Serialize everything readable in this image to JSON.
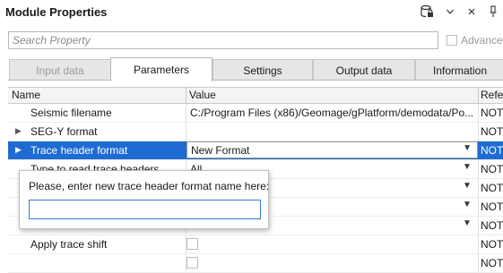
{
  "panel": {
    "title": "Module Properties",
    "search_placeholder": "Search Property",
    "advanced_label": "Advance"
  },
  "tabs": [
    {
      "label": "Input data",
      "state": "disabled"
    },
    {
      "label": "Parameters",
      "state": "active"
    },
    {
      "label": "Settings",
      "state": "normal"
    },
    {
      "label": "Output data",
      "state": "normal"
    },
    {
      "label": "Information",
      "state": "normal"
    }
  ],
  "grid": {
    "headers": {
      "name": "Name",
      "value": "Value",
      "flag": "Refer"
    },
    "rows": [
      {
        "name": "Seismic filename",
        "value": "C:/Program Files (x86)/Geomage/gPlatform/demodata/Po...",
        "flag": "NOT"
      },
      {
        "name": "SEG-Y format",
        "value": "",
        "flag": "NOT"
      },
      {
        "name": "Trace header format",
        "value": "New Format",
        "flag": "NOT"
      },
      {
        "name": "Type to read trace headers",
        "value": "All",
        "flag": "NOT"
      },
      {
        "name": "",
        "value": "",
        "flag": "NOT"
      },
      {
        "name": "",
        "value": "",
        "flag": "NOT"
      },
      {
        "name": "",
        "value": "",
        "flag": "NOT"
      },
      {
        "name": "Apply trace shift",
        "value": "",
        "flag": "NOT"
      },
      {
        "name": "",
        "value": "",
        "flag": "NOT"
      }
    ]
  },
  "popup": {
    "message": "Please, enter new trace header format name here:",
    "input_value": ""
  },
  "colors": {
    "selection": "#1e6cd2",
    "input_focus": "#2f7bd6"
  },
  "icons": [
    "settings-lock-icon",
    "chevron-down-icon",
    "close-icon",
    "pin-icon",
    "dropdown-arrow-icon",
    "expand-arrow-icon"
  ]
}
